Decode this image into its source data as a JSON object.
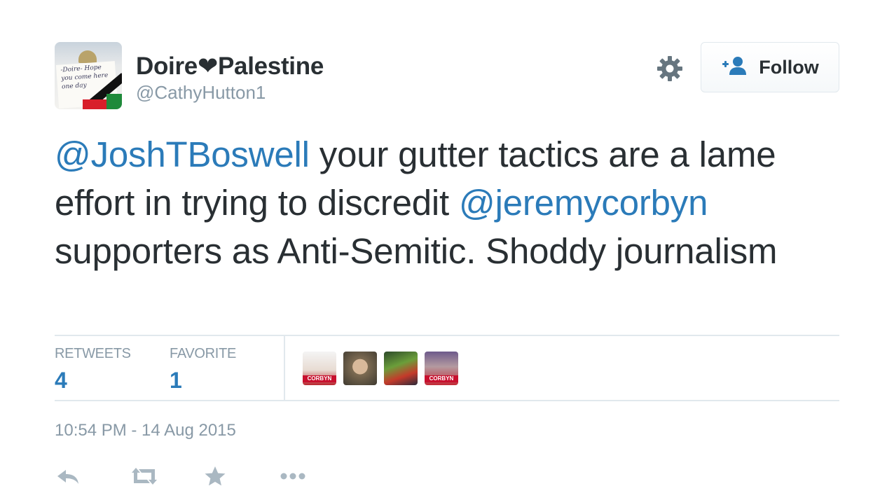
{
  "user": {
    "display_name": "Doire❤Palestine",
    "screen_name": "@CathyHutton1",
    "avatar_sign_text": "-Doire- Hope you come here one day"
  },
  "follow_button": {
    "label": "Follow"
  },
  "tweet": {
    "mention_1": "@JoshTBoswell",
    "text_1": " your gutter tactics are a lame effort in trying to discredit ",
    "mention_2": "@jeremycorbyn",
    "text_2": " supporters as Anti-Semitic. Shoddy journalism"
  },
  "stats": {
    "retweets_label": "RETWEETS",
    "retweets_count": "4",
    "favorite_label": "FAVORITE",
    "favorite_count": "1"
  },
  "favoriters": [
    {
      "tag": "CORBYN"
    },
    {
      "tag": ""
    },
    {
      "tag": ""
    },
    {
      "tag": "CORBYN"
    }
  ],
  "timestamp": "10:54 PM - 14 Aug 2015",
  "icons": {
    "settings": "gear-icon",
    "follow": "add-user-icon",
    "reply": "reply-icon",
    "retweet": "retweet-icon",
    "favorite": "star-icon",
    "more": "more-icon"
  },
  "colors": {
    "link": "#2b7bb9",
    "muted": "#8899a6",
    "text": "#292f33",
    "border": "#e1e8ed"
  }
}
